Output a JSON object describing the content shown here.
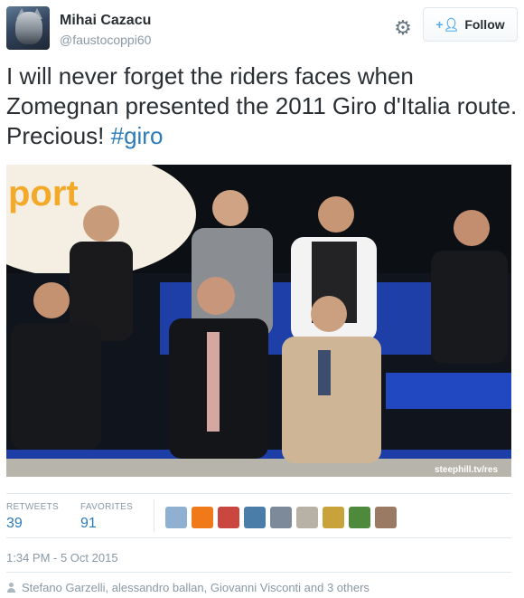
{
  "user": {
    "name": "Mihai Cazacu",
    "handle": "@faustocoppi60",
    "avatar_icon": "wolf-avatar"
  },
  "actions": {
    "settings_icon": "gear-icon",
    "follow_label": "Follow",
    "follow_icon": "add-user-icon"
  },
  "tweet": {
    "text": "I will never forget the riders faces when Zomegnan presented the 2011 Giro d'Italia route. Precious! ",
    "hashtag": "#giro"
  },
  "photo": {
    "credit": "steephill.tv/res",
    "backdrop_text": "port"
  },
  "stats": {
    "retweets_label": "RETWEETS",
    "retweets": "39",
    "favorites_label": "FAVORITES",
    "favorites": "91"
  },
  "favoriters_colors": [
    "#8fb0d0",
    "#f07a1a",
    "#c9473f",
    "#4a7ea8",
    "#7c8a99",
    "#b8b2a6",
    "#c8a23a",
    "#4f8a3c",
    "#9a7a62"
  ],
  "timestamp": "1:34 PM - 5 Oct 2015",
  "favorited_by": "Stefano Garzelli, alessandro ballan, Giovanni Visconti and 3 others",
  "colors": {
    "link": "#2b7bb9",
    "muted": "#8899a6",
    "text": "#292f33"
  }
}
